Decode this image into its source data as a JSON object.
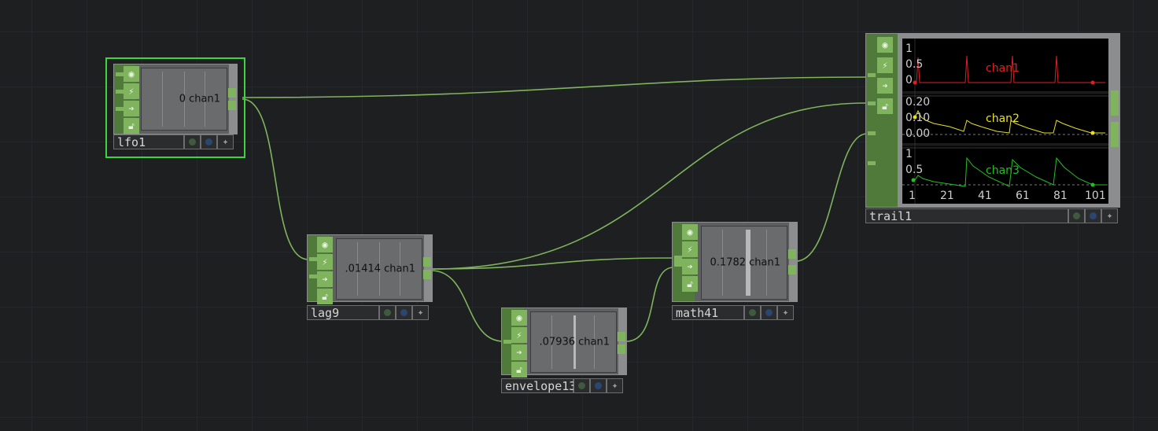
{
  "nodes": {
    "lfo1": {
      "name": "lfo1",
      "value": "0 chan1"
    },
    "lag9": {
      "name": "lag9",
      "value": ".01414 chan1"
    },
    "envelope13": {
      "name": "envelope13",
      "value": ".07936 chan1"
    },
    "math41": {
      "name": "math41",
      "value": "0.1782 chan1"
    },
    "trail1": {
      "name": "trail1",
      "channels": [
        {
          "name": "chan1",
          "color": "#e02020",
          "ticks": [
            "1",
            "0.5",
            "0"
          ]
        },
        {
          "name": "chan2",
          "color": "#e8e020",
          "ticks": [
            "0.20",
            "0.10",
            "0.00"
          ]
        },
        {
          "name": "chan3",
          "color": "#20c020",
          "ticks": [
            "1",
            "0.5"
          ]
        }
      ],
      "x_ticks": [
        "1",
        "21",
        "41",
        "61",
        "81",
        "101"
      ]
    }
  },
  "icons": [
    "viewer-toggle-icon",
    "cook-icon",
    "bypass-icon",
    "lock-icon"
  ],
  "colors": {
    "background": "#1d1f21",
    "wire": "#7fb35d",
    "selected": "#3fd33f"
  }
}
